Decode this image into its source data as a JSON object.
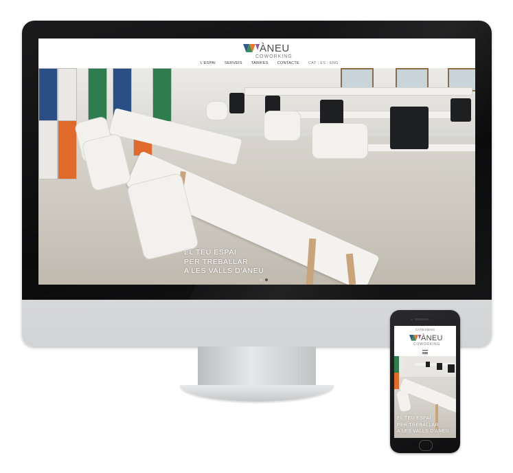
{
  "site": {
    "brand_name": "ÀNEU",
    "brand_tagline": "COWORKING",
    "nav": [
      {
        "label": "L'ESPAI"
      },
      {
        "label": "SERVEIS"
      },
      {
        "label": "TARIFES"
      },
      {
        "label": "CONTACTE"
      }
    ],
    "languages": [
      "CAT",
      "ES",
      "ENG"
    ],
    "lang_separator": "|",
    "hero": {
      "caption_lines": [
        "EL TEU ESPAI",
        "PER TREBALLAR",
        "A LES VALLS D'ÀNEU"
      ],
      "slides": 2,
      "active_slide": 2
    }
  },
  "mobile": {
    "languages_text": "CAT|ES|ENG",
    "menu_icon": "hamburger-icon"
  },
  "colors": {
    "logo_blue": "#2f5d8c",
    "logo_orange": "#e57a2e",
    "logo_green": "#3c8d5a",
    "text_dark": "#333333"
  }
}
